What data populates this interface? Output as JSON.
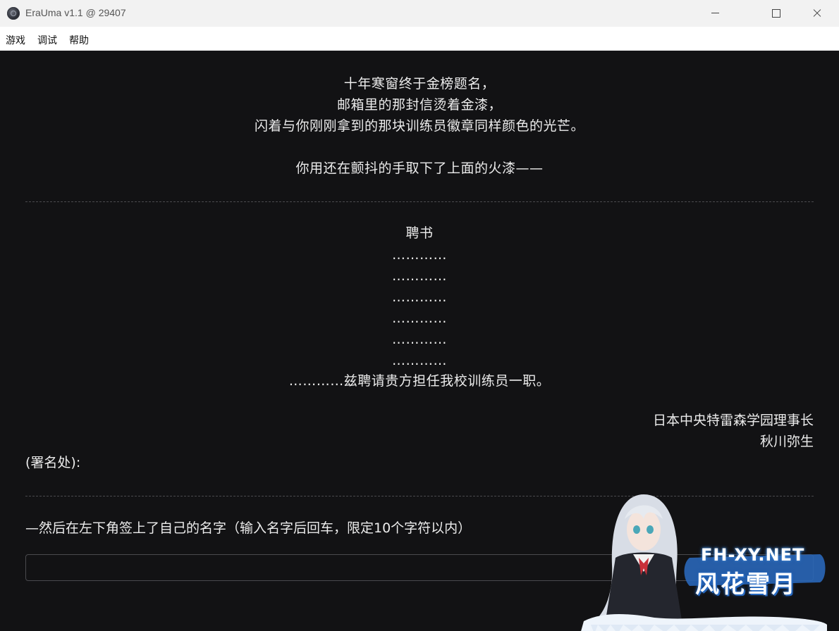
{
  "window": {
    "title": "EraUma v1.1 @ 29407"
  },
  "menu": {
    "items": [
      "游戏",
      "调试",
      "帮助"
    ]
  },
  "intro": {
    "lines": [
      "十年寒窗终于金榜题名，",
      "邮箱里的那封信烫着金漆，",
      "闪着与你刚刚拿到的那块训练员徽章同样颜色的光芒。",
      "你用还在颤抖的手取下了上面的火漆——"
    ]
  },
  "letter": {
    "title": "聘书",
    "dots": [
      "…………",
      "…………",
      "…………",
      "…………",
      "…………",
      "…………"
    ],
    "body": "…………兹聘请贵方担任我校训练员一职。",
    "sign_org": "日本中央特雷森学园理事长",
    "sign_name": "秋川弥生",
    "signature_label": "(署名处):"
  },
  "prompt": {
    "text": "—然后在左下角签上了自己的名字（输入名字后回车，限定10个字符以内）",
    "input_value": "",
    "input_placeholder": ""
  },
  "watermark": {
    "site": "FH-XY.NET",
    "name": "风花雪月"
  },
  "colors": {
    "background": "#121214",
    "text": "#ececec",
    "titlebar": "#f2f2f2",
    "watermark_blue": "#2c6fc8"
  }
}
